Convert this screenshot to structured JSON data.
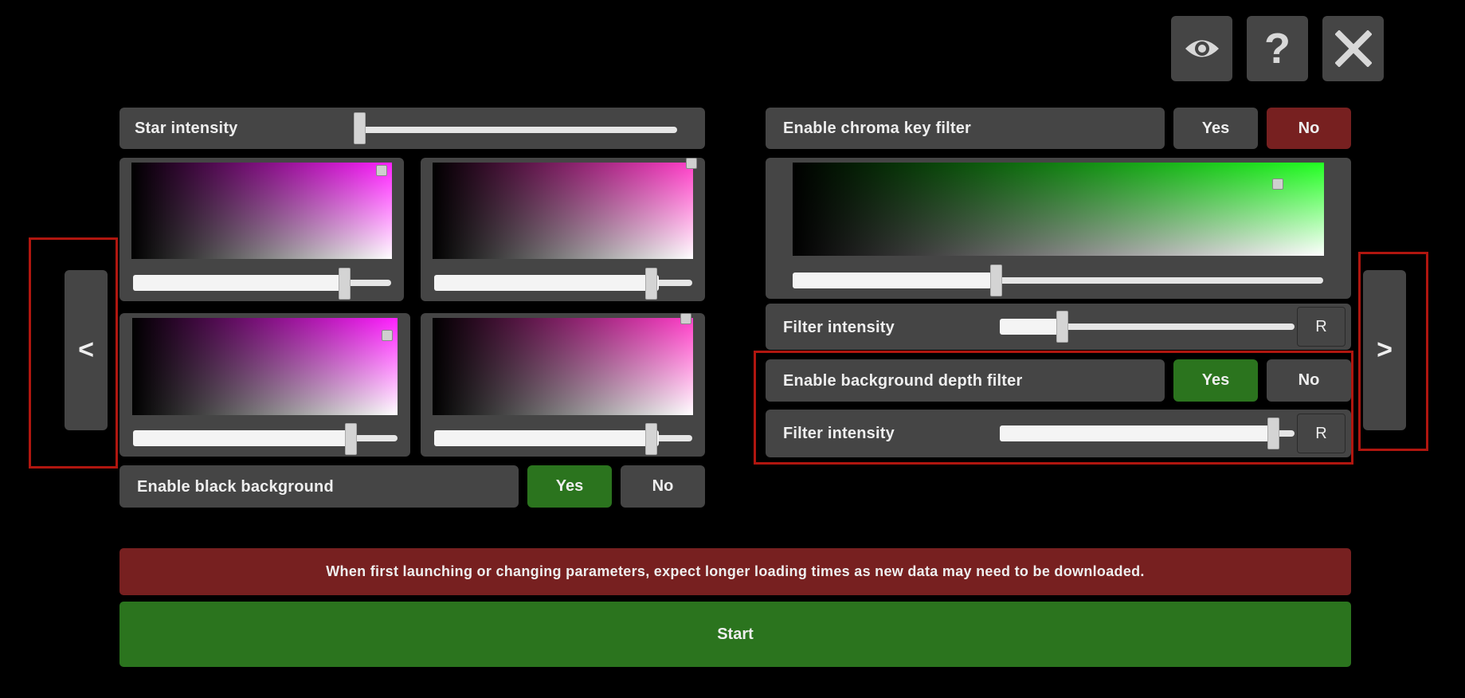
{
  "top_icons": [
    "eye-icon",
    "question-icon",
    "close-icon"
  ],
  "nav": {
    "prev_label": "<",
    "next_label": ">"
  },
  "star": {
    "label": "Star intensity",
    "value": 0.0
  },
  "color_pickers": [
    {
      "hue": "#ff20ff",
      "brightness": 0.82
    },
    {
      "hue": "#ff3ec8",
      "brightness": 0.94
    },
    {
      "hue": "#ff20ff",
      "brightness": 0.83
    },
    {
      "hue": "#ff3ec8",
      "brightness": 0.84
    }
  ],
  "black_bg": {
    "label": "Enable black background",
    "yes": "Yes",
    "no": "No",
    "selected": "yes"
  },
  "chroma": {
    "label": "Enable chroma key filter",
    "yes": "Yes",
    "no": "No",
    "selected": "no",
    "hue": "#22ff22",
    "slider": 0.38
  },
  "chroma_intensity": {
    "label": "Filter intensity",
    "value": 0.22,
    "reset": "R"
  },
  "depth": {
    "label": "Enable background depth filter",
    "yes": "Yes",
    "no": "No",
    "selected": "yes"
  },
  "depth_intensity": {
    "label": "Filter intensity",
    "value": 0.94,
    "reset": "R"
  },
  "warning": "When first launching or changing parameters, expect longer loading times as new data may need to be downloaded.",
  "start_label": "Start",
  "colors": {
    "green": "#2b741e",
    "red": "#772020",
    "panel": "#454545",
    "highlight": "#b0160f"
  }
}
